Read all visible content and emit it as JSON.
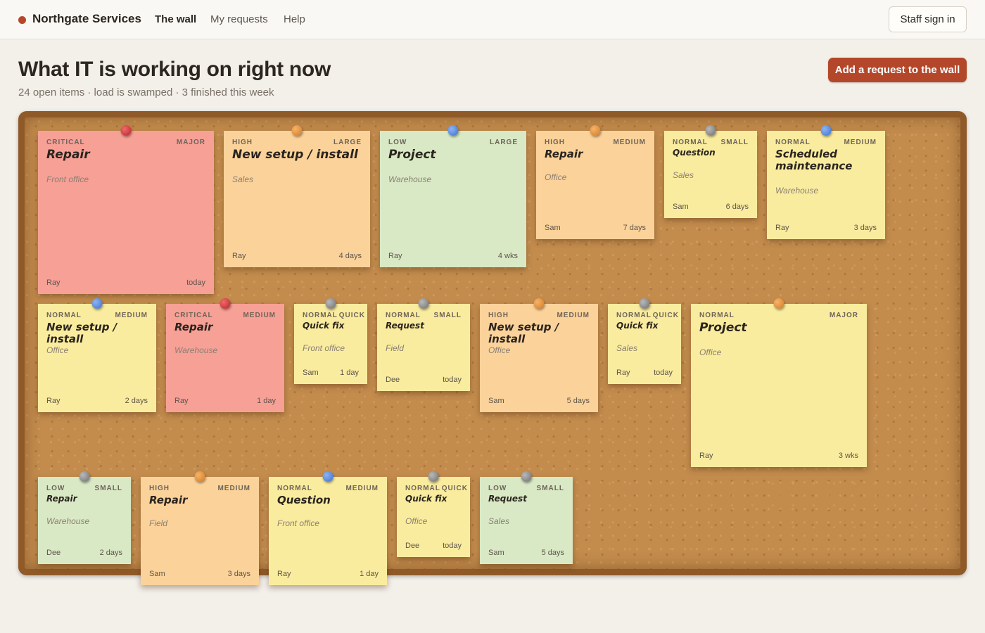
{
  "nav": {
    "brand": "Northgate Services",
    "links": [
      "The wall",
      "My requests",
      "Help"
    ],
    "signin": "Staff sign in"
  },
  "header": {
    "title": "What IT is working on right now",
    "subline": "24 open items · load is swamped · 3 finished this week",
    "add_button": "Add a request to the wall"
  },
  "notes": [
    {
      "priority": "CRITICAL",
      "size": "MAJOR",
      "title": "Repair",
      "location": "Front office",
      "assignee": "Ray",
      "age": "today",
      "color": "red",
      "pin": "red"
    },
    {
      "priority": "HIGH",
      "size": "LARGE",
      "title": "New setup / install",
      "location": "Sales",
      "assignee": "Ray",
      "age": "4 days",
      "color": "orange",
      "pin": "orange"
    },
    {
      "priority": "LOW",
      "size": "LARGE",
      "title": "Project",
      "location": "Warehouse",
      "assignee": "Ray",
      "age": "4 wks",
      "color": "green",
      "pin": "blue"
    },
    {
      "priority": "HIGH",
      "size": "MEDIUM",
      "title": "Repair",
      "location": "Office",
      "assignee": "Sam",
      "age": "7 days",
      "color": "orange",
      "pin": "orange"
    },
    {
      "priority": "NORMAL",
      "size": "SMALL",
      "title": "Question",
      "location": "Sales",
      "assignee": "Sam",
      "age": "6 days",
      "color": "yellow",
      "pin": "gray"
    },
    {
      "priority": "NORMAL",
      "size": "MEDIUM",
      "title": "Scheduled maintenance",
      "location": "Warehouse",
      "assignee": "Ray",
      "age": "3 days",
      "color": "yellow",
      "pin": "blue"
    },
    {
      "priority": "NORMAL",
      "size": "MEDIUM",
      "title": "New setup / install",
      "location": "Office",
      "assignee": "Ray",
      "age": "2 days",
      "color": "yellow",
      "pin": "blue"
    },
    {
      "priority": "CRITICAL",
      "size": "MEDIUM",
      "title": "Repair",
      "location": "Warehouse",
      "assignee": "Ray",
      "age": "1 day",
      "color": "red",
      "pin": "red"
    },
    {
      "priority": "NORMAL",
      "size": "QUICK",
      "title": "Quick fix",
      "location": "Front office",
      "assignee": "Sam",
      "age": "1 day",
      "color": "yellow",
      "pin": "gray"
    },
    {
      "priority": "NORMAL",
      "size": "SMALL",
      "title": "Request",
      "location": "Field",
      "assignee": "Dee",
      "age": "today",
      "color": "yellow",
      "pin": "gray"
    },
    {
      "priority": "HIGH",
      "size": "MEDIUM",
      "title": "New setup / install",
      "location": "Office",
      "assignee": "Sam",
      "age": "5 days",
      "color": "orange",
      "pin": "orange"
    },
    {
      "priority": "NORMAL",
      "size": "QUICK",
      "title": "Quick fix",
      "location": "Sales",
      "assignee": "Ray",
      "age": "today",
      "color": "yellow",
      "pin": "gray"
    },
    {
      "priority": "NORMAL",
      "size": "MAJOR",
      "title": "Project",
      "location": "Office",
      "assignee": "Ray",
      "age": "3 wks",
      "color": "yellow",
      "pin": "orange"
    },
    {
      "priority": "LOW",
      "size": "SMALL",
      "title": "Repair",
      "location": "Warehouse",
      "assignee": "Dee",
      "age": "2 days",
      "color": "green",
      "pin": "gray"
    },
    {
      "priority": "HIGH",
      "size": "MEDIUM",
      "title": "Repair",
      "location": "Field",
      "assignee": "Sam",
      "age": "3 days",
      "color": "orange",
      "pin": "orange"
    },
    {
      "priority": "NORMAL",
      "size": "MEDIUM",
      "title": "Question",
      "location": "Front office",
      "assignee": "Ray",
      "age": "1 day",
      "color": "yellow",
      "pin": "blue"
    },
    {
      "priority": "NORMAL",
      "size": "QUICK",
      "title": "Quick fix",
      "location": "Office",
      "assignee": "Dee",
      "age": "today",
      "color": "yellow",
      "pin": "gray"
    },
    {
      "priority": "LOW",
      "size": "SMALL",
      "title": "Request",
      "location": "Sales",
      "assignee": "Sam",
      "age": "5 days",
      "color": "green",
      "pin": "gray"
    }
  ]
}
